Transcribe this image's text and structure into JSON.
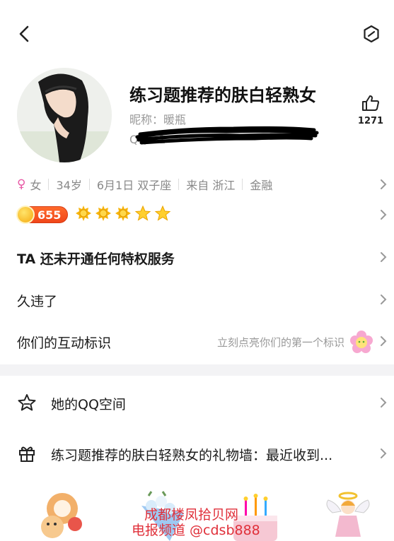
{
  "profile": {
    "title": "练习题推荐的肤白轻熟女",
    "nick_label": "昵称：",
    "nick_value": "暖瓶",
    "qq_label": "QQ：",
    "qq_partial": "1",
    "likes": "1271"
  },
  "info": {
    "gender": "女",
    "age": "34岁",
    "birthday": "6月1日 双子座",
    "hometown": "来自 浙江",
    "industry": "金融"
  },
  "level": {
    "value": "655"
  },
  "rows": {
    "privilege": "TA 还未开通任何特权服务",
    "status": "久违了",
    "interaction": "你们的互动标识",
    "interaction_hint": "立刻点亮你们的第一个标识"
  },
  "list": {
    "qzone": "她的QQ空间",
    "gift_wall": "练习题推荐的肤白轻熟女的礼物墙：最近收到..."
  },
  "watermark": {
    "line1": "成都楼凤拾贝网",
    "line2": "电报频道 @cdsb888"
  },
  "colors": {
    "accent_female": "#e85aa6",
    "coin_badge": "#f0461a",
    "watermark": "#e0303a",
    "section_band": "#f3f3f5"
  },
  "icons": [
    "back-arrow-icon",
    "hexagon-more-icon",
    "thumbs-up-icon",
    "female-icon",
    "coin-icon",
    "sun-badge-icon",
    "star-badge-icon",
    "chevron-right-icon",
    "flower-icon",
    "star-outline-icon",
    "gift-icon"
  ]
}
